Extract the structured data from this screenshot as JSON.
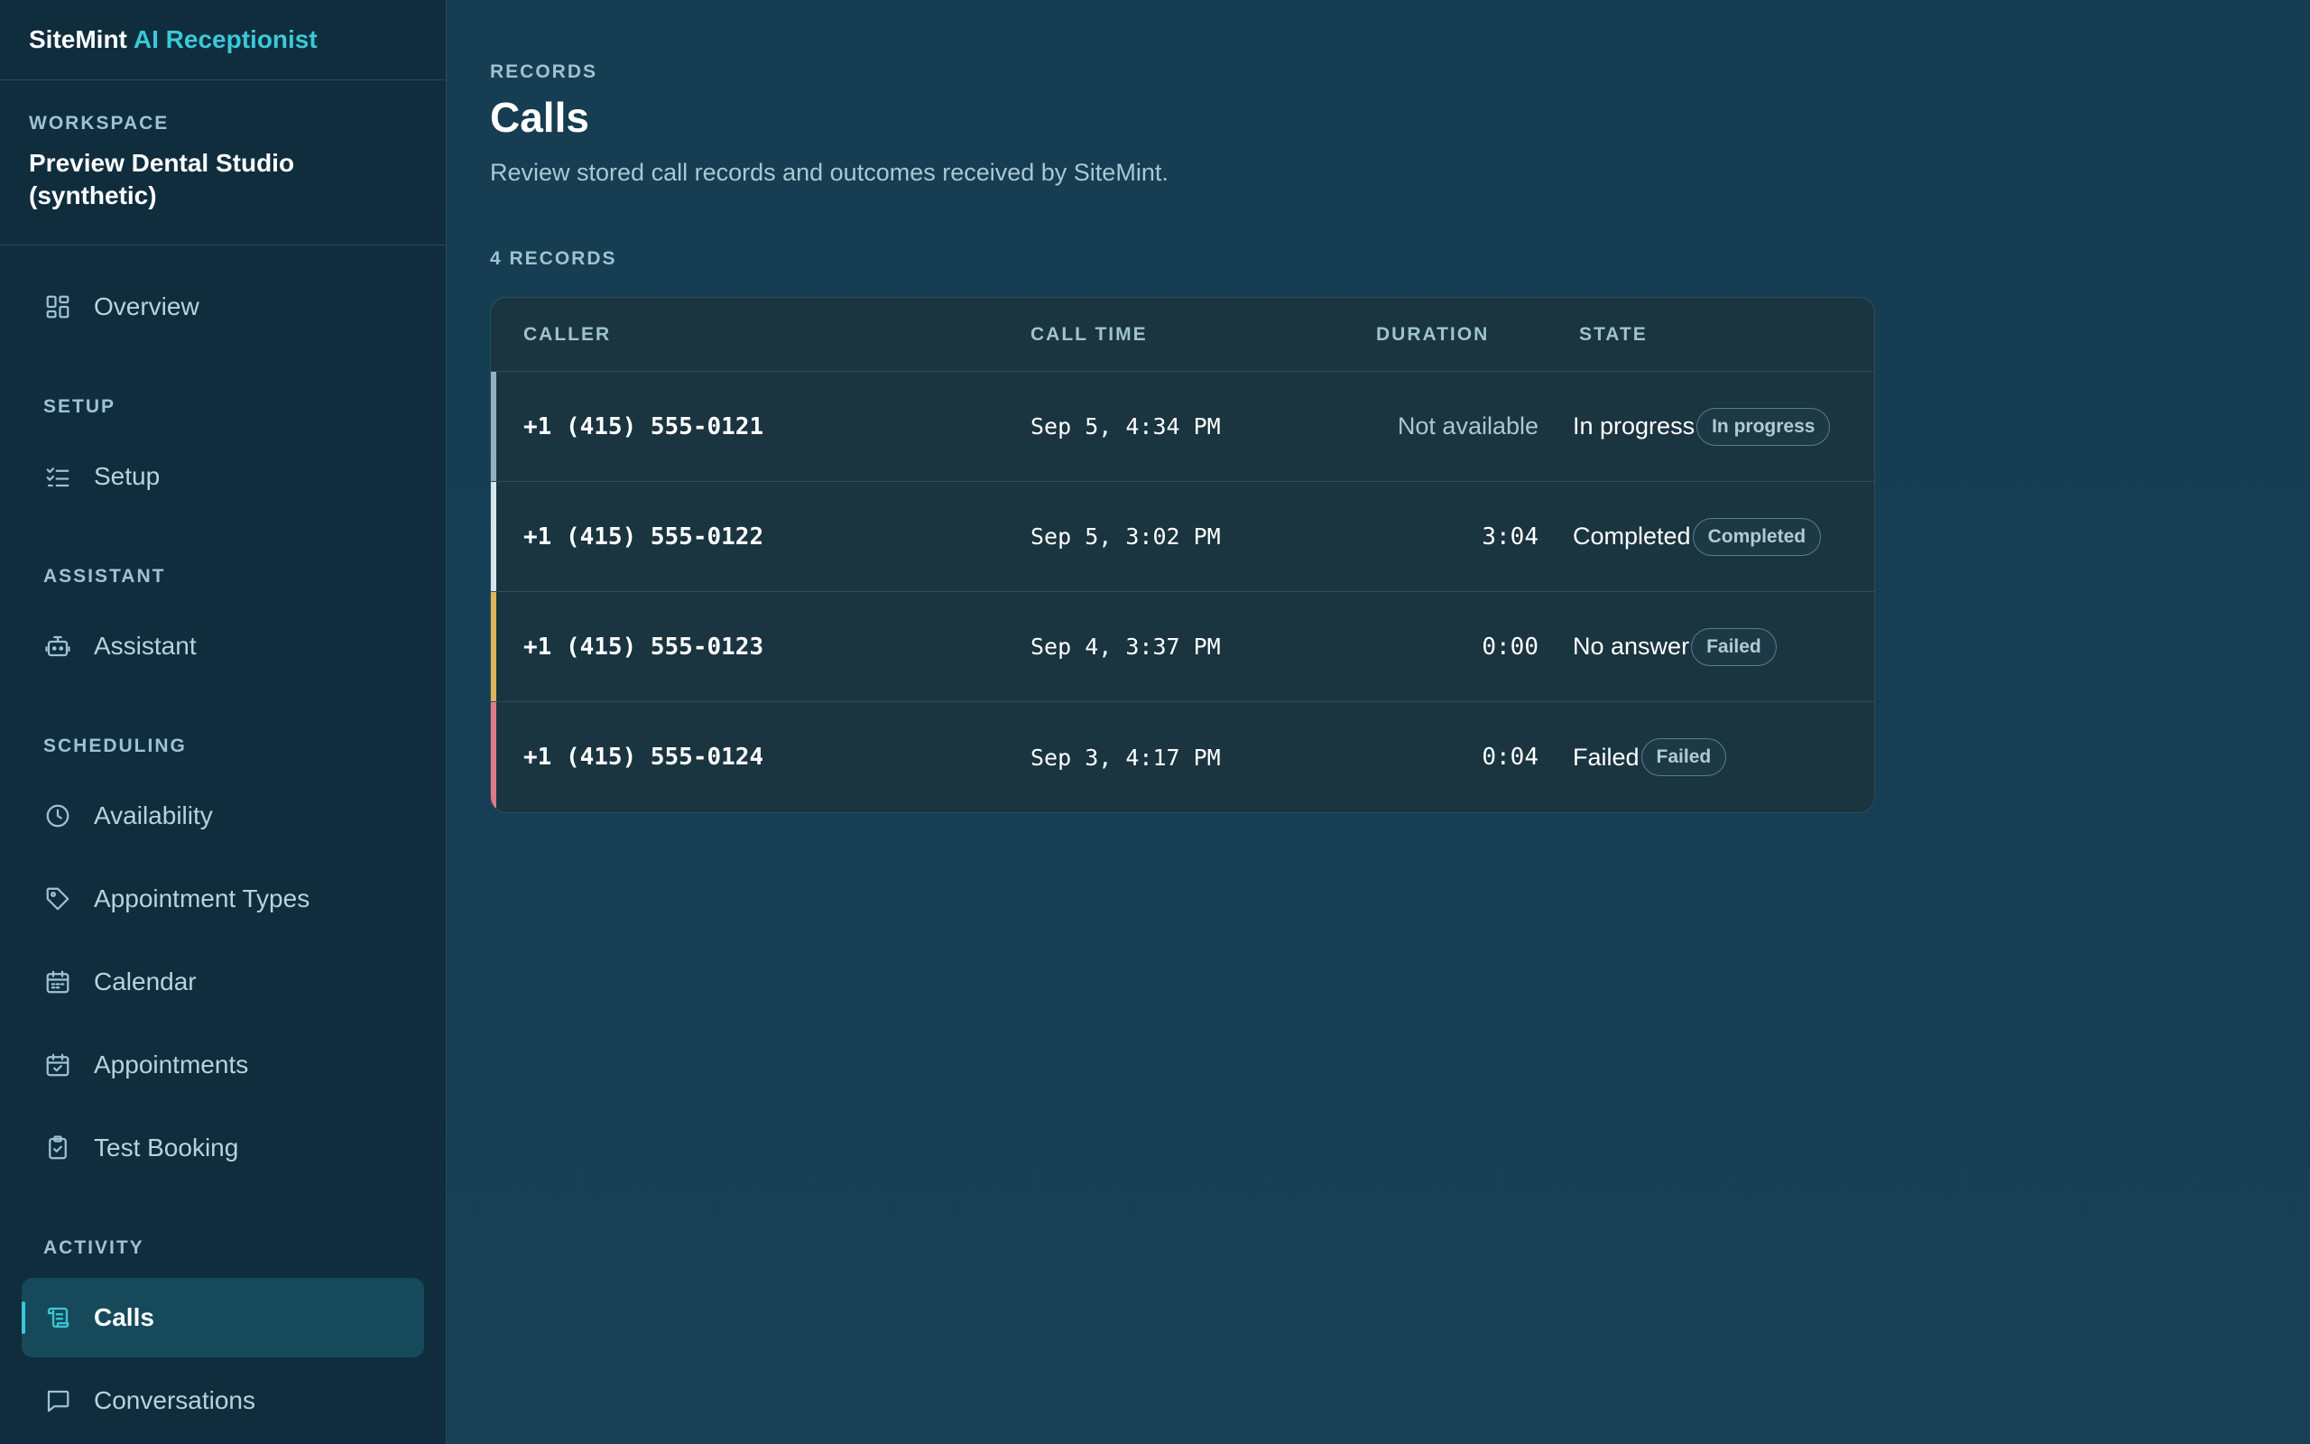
{
  "brand": {
    "name": "SiteMint",
    "accent": "AI Receptionist"
  },
  "workspace": {
    "label": "WORKSPACE",
    "name": "Preview Dental Studio (synthetic)"
  },
  "nav": {
    "overview": "Overview",
    "setup_section": "SETUP",
    "setup": "Setup",
    "assistant_section": "ASSISTANT",
    "assistant": "Assistant",
    "scheduling_section": "SCHEDULING",
    "availability": "Availability",
    "appointment_types": "Appointment Types",
    "calendar": "Calendar",
    "appointments": "Appointments",
    "test_booking": "Test Booking",
    "activity_section": "ACTIVITY",
    "calls": "Calls",
    "conversations": "Conversations"
  },
  "page": {
    "eyebrow": "RECORDS",
    "title": "Calls",
    "description": "Review stored call records and outcomes received by SiteMint.",
    "record_count": "4 RECORDS"
  },
  "table": {
    "headers": {
      "caller": "CALLER",
      "call_time": "CALL TIME",
      "duration": "DURATION",
      "state": "STATE"
    },
    "rows": [
      {
        "caller": "+1 (415) 555-0121",
        "call_time": "Sep 5, 4:34 PM",
        "duration": "Not available",
        "state": "In progress",
        "badge": "In progress",
        "accent": "#8fb3bf"
      },
      {
        "caller": "+1 (415) 555-0122",
        "call_time": "Sep 5, 3:02 PM",
        "duration": "3:04",
        "state": "Completed",
        "badge": "Completed",
        "accent": "#d8e6ea"
      },
      {
        "caller": "+1 (415) 555-0123",
        "call_time": "Sep 4, 3:37 PM",
        "duration": "0:00",
        "state": "No answer",
        "badge": "Failed",
        "accent": "#e0b45a"
      },
      {
        "caller": "+1 (415) 555-0124",
        "call_time": "Sep 3, 4:17 PM",
        "duration": "0:04",
        "state": "Failed",
        "badge": "Failed",
        "accent": "#e07a86"
      }
    ]
  },
  "colors": {
    "accent": "#3cc8d8",
    "sidebar_bg": "#0f2d3d",
    "main_bg": "#163d52"
  },
  "icons": {
    "overview": "grid-icon",
    "setup": "checklist-icon",
    "assistant": "robot-icon",
    "availability": "clock-icon",
    "appointment_types": "tag-icon",
    "calendar": "calendar-icon",
    "appointments": "calendar-check-icon",
    "test_booking": "clipboard-icon",
    "calls": "scroll-icon",
    "conversations": "chat-icon"
  }
}
